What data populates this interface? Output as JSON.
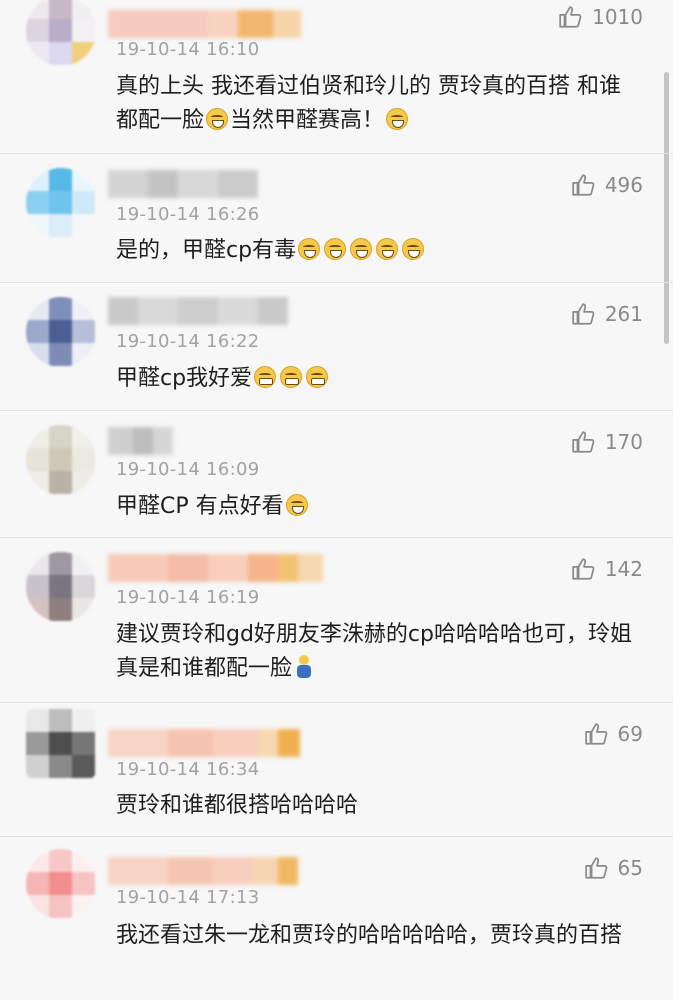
{
  "comments": [
    {
      "time": "19-10-14 16:10",
      "likes": "1010",
      "text": "真的上头 我还看过伯贤和玲儿的 贾玲真的百搭 和谁都配一脸",
      "text_after": "当然甲醛赛高！",
      "emojis": [
        "laugh-cry-icon"
      ],
      "emojis_end": [
        "laugh-cry-icon"
      ]
    },
    {
      "time": "19-10-14 16:26",
      "likes": "496",
      "text": "是的，甲醛cp有毒",
      "emojis": [
        "laugh-cry-icon",
        "laugh-cry-icon",
        "laugh-cry-icon",
        "laugh-cry-icon",
        "laugh-cry-icon"
      ]
    },
    {
      "time": "19-10-14 16:22",
      "likes": "261",
      "text": "甲醛cp我好爱",
      "emojis": [
        "grin-icon",
        "grin-icon",
        "grin-icon"
      ]
    },
    {
      "time": "19-10-14 16:09",
      "likes": "170",
      "text": "甲醛CP 有点好看",
      "emojis": [
        "laugh-cry-icon"
      ]
    },
    {
      "time": "19-10-14 16:19",
      "likes": "142",
      "text": "建议贾玲和gd好朋友李洙赫的cp哈哈哈哈也可，玲姐真是和谁都配一脸",
      "emojis": [
        "kneel-icon"
      ]
    },
    {
      "time": "19-10-14 16:34",
      "likes": "69",
      "text": "贾玲和谁都很搭哈哈哈哈",
      "emojis": []
    },
    {
      "time": "19-10-14 17:13",
      "likes": "65",
      "text": "我还看过朱一龙和贾玲的哈哈哈哈哈，贾玲真的百搭",
      "emojis": []
    }
  ]
}
